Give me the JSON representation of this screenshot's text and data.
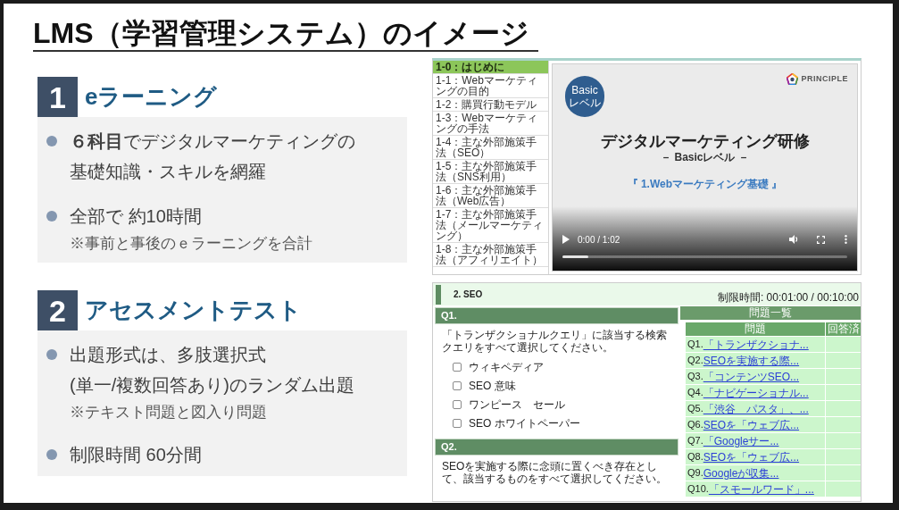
{
  "title": "LMS（学習管理システム）のイメージ",
  "sections": [
    {
      "number": "1",
      "heading": "eラーニング",
      "items": [
        {
          "lines": [
            "**６科目**でデジタルマーケティングの",
            "基礎知識・スキルを網羅"
          ]
        },
        {
          "lines": [
            "全部で 約10時間"
          ],
          "note": "※事前と事後のｅラーニングを合計"
        }
      ]
    },
    {
      "number": "2",
      "heading": "アセスメントテスト",
      "items": [
        {
          "lines": [
            "出題形式は、多肢選択式",
            "(単一/複数回答あり)のランダム出題"
          ],
          "note": "※テキスト問題と図入り問題"
        },
        {
          "lines": [
            "制限時間 60分間"
          ]
        }
      ]
    }
  ],
  "lms_player": {
    "chapters": [
      {
        "label": "1-0：はじめに",
        "selected": true
      },
      {
        "label": "1-1：Webマーケティングの目的",
        "selected": false
      },
      {
        "label": "1-2：購買行動モデル",
        "selected": false
      },
      {
        "label": "1-3：Webマーケティングの手法",
        "selected": false
      },
      {
        "label": "1-4：主な外部施策手法（SEO）",
        "selected": false
      },
      {
        "label": "1-5：主な外部施策手法（SNS利用）",
        "selected": false
      },
      {
        "label": "1-6：主な外部施策手法（Web広告）",
        "selected": false
      },
      {
        "label": "1-7：主な外部施策手法（メールマーケティング）",
        "selected": false
      },
      {
        "label": "1-8：主な外部施策手法（アフィリエイト）",
        "selected": false
      }
    ],
    "video": {
      "badge_lines": [
        "Basic",
        "レベル"
      ],
      "logo_text": "PRINCIPLE",
      "slide_title": "デジタルマーケティング研修",
      "slide_subtitle": "－ Basicレベル －",
      "slide_course": "『 1.Webマーケティング基礎 』",
      "time": "0:00 / 1:02",
      "progress": {
        "level": 0.09
      }
    }
  },
  "quiz": {
    "section_title": "2. SEO",
    "timer": "制限時間: 00:01:00 / 00:10:00",
    "questions": [
      {
        "number": "Q1.",
        "text": "「トランザクショナルクエリ」に該当する検索クエリをすべて選択してください。",
        "options": [
          {
            "label": "ウィキペディア",
            "checked": false
          },
          {
            "label": "SEO 意味",
            "checked": false
          },
          {
            "label": "ワンピース　セール",
            "checked": false
          },
          {
            "label": "SEO ホワイトペーパー",
            "checked": false
          }
        ]
      },
      {
        "number": "Q2.",
        "text": "SEOを実施する際に念頭に置くべき存在として、該当するものをすべて選択してください。"
      }
    ],
    "list_title": "問題一覧",
    "list_columns": [
      "問題",
      "回答済"
    ],
    "list_rows": [
      {
        "number": "Q1.",
        "link": "「トランザクショナ..."
      },
      {
        "number": "Q2.",
        "link": "SEOを実施する際..."
      },
      {
        "number": "Q3.",
        "link": "「コンテンツSEO..."
      },
      {
        "number": "Q4.",
        "link": "「ナビゲーショナル..."
      },
      {
        "number": "Q5.",
        "link": "「渋谷　パスタ」、..."
      },
      {
        "number": "Q6.",
        "link": "SEOを「ウェブ広..."
      },
      {
        "number": "Q7.",
        "link": "「Googleサー..."
      },
      {
        "number": "Q8.",
        "link": "SEOを「ウェブ広..."
      },
      {
        "number": "Q9.",
        "link": "Googleが収集..."
      },
      {
        "number": "Q10.",
        "link": "「スモールワード」..."
      }
    ]
  }
}
